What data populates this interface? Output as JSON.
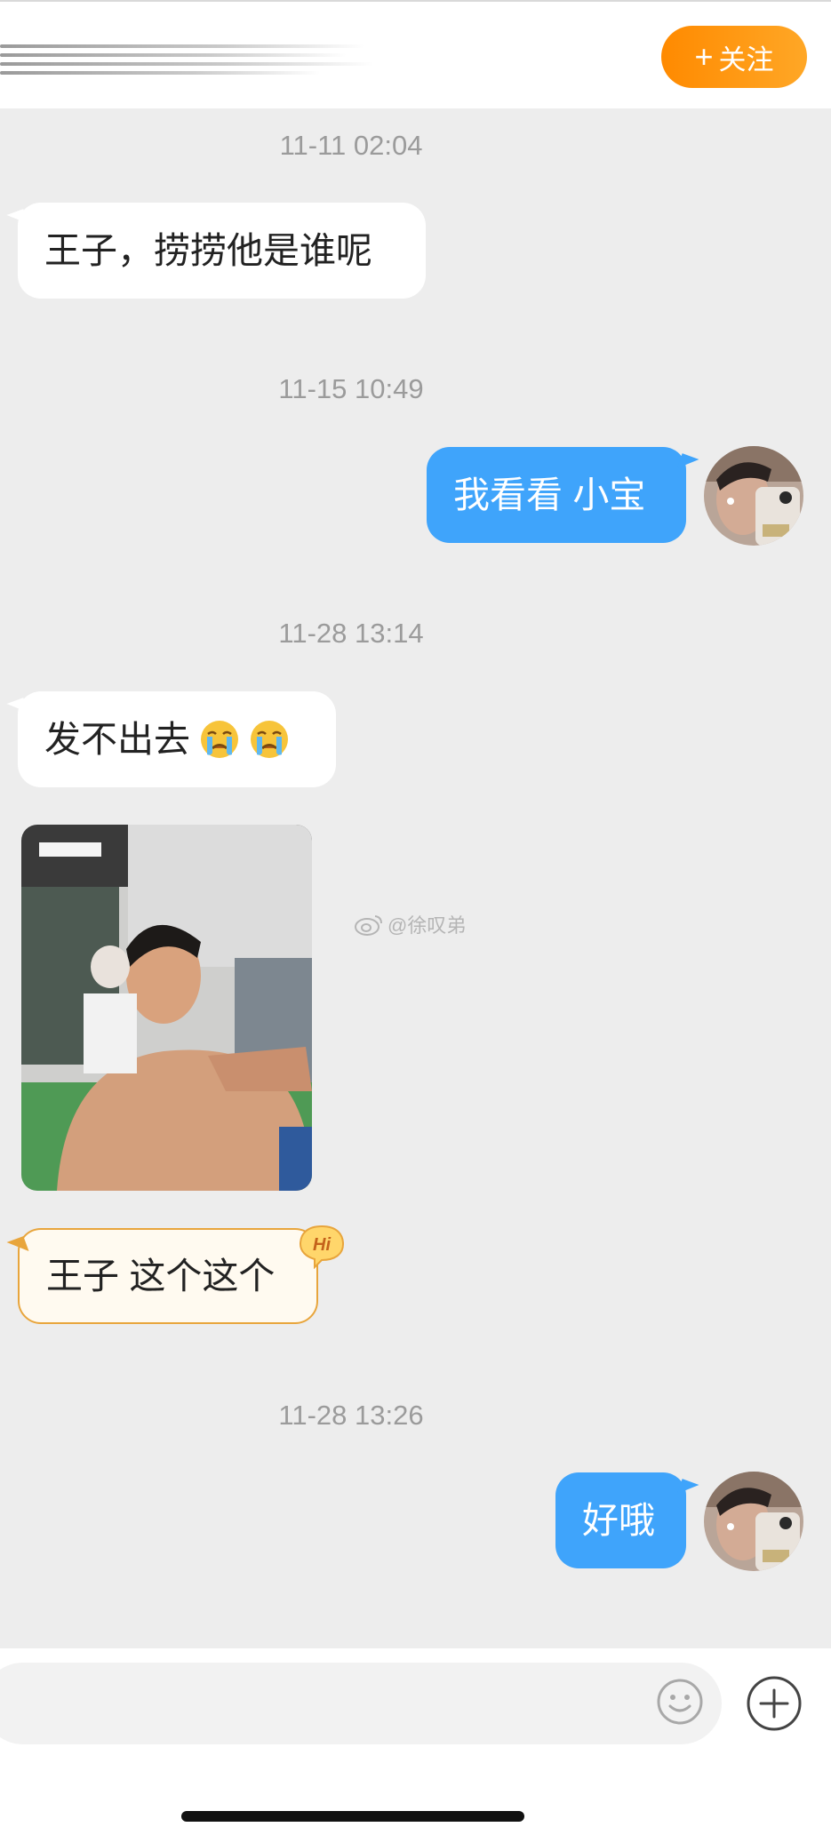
{
  "header": {
    "follow_label": "关注",
    "follow_plus": "+"
  },
  "messages": [
    {
      "kind": "timestamp",
      "text": "11-11 02:04"
    },
    {
      "kind": "incoming",
      "text": "王子，捞捞他是谁呢"
    },
    {
      "kind": "timestamp",
      "text": "11-15 10:49"
    },
    {
      "kind": "outgoing",
      "text": "我看看 小宝"
    },
    {
      "kind": "timestamp",
      "text": "11-28 13:14"
    },
    {
      "kind": "incoming",
      "text": "发不出去",
      "emoji": [
        "crying-face",
        "crying-face"
      ]
    },
    {
      "kind": "incoming-image",
      "image": "gym-selfie-photo"
    },
    {
      "kind": "incoming-greeting",
      "text": "王子 这个这个",
      "badge": "Hi"
    },
    {
      "kind": "timestamp",
      "text": "11-28 13:26"
    },
    {
      "kind": "outgoing",
      "text": "好哦"
    }
  ],
  "watermark": {
    "text": "@徐叹弟",
    "icon": "weibo-icon"
  },
  "input": {
    "emoji_icon": "smiley-icon",
    "add_icon": "plus-circle-icon"
  },
  "colors": {
    "background": "#ededed",
    "outgoing_bubble": "#3fa4fb",
    "incoming_bubble": "#ffffff",
    "follow_button": "#ff9800",
    "greeting_border": "#e8a53c"
  }
}
